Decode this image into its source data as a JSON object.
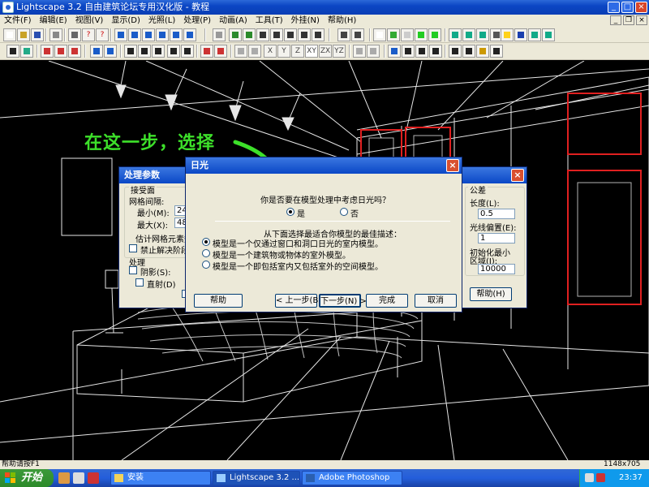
{
  "window": {
    "title": "Lightscape 3.2 自由建筑论坛专用汉化版  - 教程",
    "controls": {
      "minimize": "_",
      "maximize": "□",
      "close": "×"
    }
  },
  "menubar": {
    "items": [
      "文件(F)",
      "编辑(E)",
      "视图(V)",
      "显示(D)",
      "光照(L)",
      "处理(P)",
      "动画(A)",
      "工具(T)",
      "外挂(N)",
      "帮助(H)"
    ]
  },
  "toolbar2": {
    "axis_labels": [
      "X",
      "Y",
      "Z",
      "XY",
      "ZX",
      "YZ"
    ]
  },
  "annotation": {
    "text": "在这一步，选择"
  },
  "process_dialog": {
    "title": "处理参数",
    "receiving_group": "接受面",
    "mesh_spacing": "网格间隔:",
    "min_label": "最小(M):",
    "min_value": "240",
    "max_label": "最大(X):",
    "max_value": "480",
    "estimate": "估计网格元素数",
    "disable_stage": "禁止解决阶段",
    "process_group": "处理",
    "shadow": "阴影(S):",
    "direct": "直射(D)",
    "tolerance_group": "公差",
    "length_label": "长度(L):",
    "length_value": "0.5",
    "light_bias_label": "光线偏置(E):",
    "light_bias_value": "1",
    "init_min_label_1": "初始化最小",
    "init_min_label_2": "区域(I):",
    "init_min_value": "10000",
    "help_button": "帮助(H)"
  },
  "daylight_dialog": {
    "title": "日光",
    "question": "你是否要在模型处理中考虑日光吗？",
    "yes": "是",
    "no": "否",
    "describe_prompt": "从下面选择最适合你模型的最佳描述：",
    "options": [
      "模型是一个仅通过窗口和洞口日光的室内模型。",
      "模型是一个建筑物或物体的室外模型。",
      "模型是一个即包括室内又包括室外的空间模型。"
    ],
    "selected_option": 0,
    "buttons": {
      "help": "帮助",
      "back": "< 上一步(B)",
      "next": "下一步(N) >",
      "finish": "完成",
      "cancel": "取消"
    }
  },
  "statusbar": {
    "left": "帮助请按F1",
    "right": "1148x705"
  },
  "taskbar": {
    "start": "开始",
    "tasks": [
      {
        "label": "安装"
      },
      {
        "label": "Lightscape 3.2 ..."
      },
      {
        "label": "Adobe Photoshop"
      }
    ],
    "clock": "23:37"
  },
  "colors": {
    "annotation": "#3de02a",
    "title_bar": "#0a46c4",
    "dialog_face": "#ece9d8",
    "wire": "#ffffff",
    "window_frame": "#e02020"
  }
}
